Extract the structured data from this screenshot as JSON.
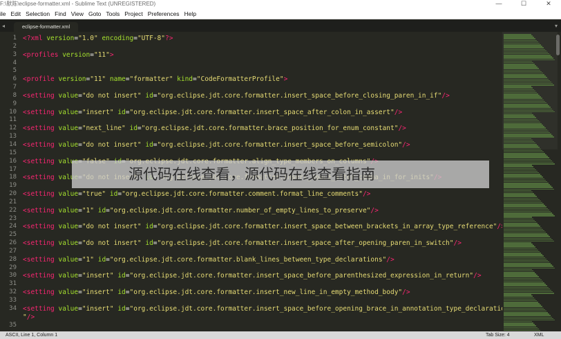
{
  "window": {
    "title": "F:\\默陈\\eclipse-formatter.xml - Sublime Text (UNREGISTERED)",
    "minimize": "—",
    "maximize": "☐",
    "close": "✕"
  },
  "menu": {
    "items": [
      "ile",
      "Edit",
      "Selection",
      "Find",
      "View",
      "Goto",
      "Tools",
      "Project",
      "Preferences",
      "Help"
    ]
  },
  "tabs": {
    "active": "eclipse-formatter.xml",
    "left_arrow": "◂",
    "right_arrow": "▾"
  },
  "editor": {
    "line_numbers": [
      "1",
      "2",
      "3",
      "4",
      "5",
      "6",
      "7",
      "8",
      "9",
      "10",
      "11",
      "12",
      "13",
      "14",
      "15",
      "16",
      "17",
      "18",
      "19",
      "20",
      "21",
      "22",
      "23",
      "24",
      "25",
      "26",
      "27",
      "28",
      "29",
      "30",
      "31",
      "32",
      "33",
      "34",
      "",
      "35"
    ],
    "lines": [
      [
        [
          "t",
          "<?xml"
        ],
        [
          "a",
          " version"
        ],
        [
          "p",
          "="
        ],
        [
          "s",
          "\"1.0\""
        ],
        [
          "a",
          " encoding"
        ],
        [
          "p",
          "="
        ],
        [
          "s",
          "\"UTF-8\""
        ],
        [
          "t",
          "?>"
        ]
      ],
      [],
      [
        [
          "t",
          "<profiles"
        ],
        [
          "a",
          " version"
        ],
        [
          "p",
          "="
        ],
        [
          "s",
          "\"11\""
        ],
        [
          "t",
          ">"
        ]
      ],
      [],
      [],
      [
        [
          "t",
          "<profile"
        ],
        [
          "a",
          " version"
        ],
        [
          "p",
          "="
        ],
        [
          "s",
          "\"11\""
        ],
        [
          "a",
          " name"
        ],
        [
          "p",
          "="
        ],
        [
          "s",
          "\"formatter\""
        ],
        [
          "a",
          " kind"
        ],
        [
          "p",
          "="
        ],
        [
          "s",
          "\"CodeFormatterProfile\""
        ],
        [
          "t",
          ">"
        ]
      ],
      [],
      [
        [
          "t",
          "<setting"
        ],
        [
          "a",
          " value"
        ],
        [
          "p",
          "="
        ],
        [
          "s",
          "\"do not insert\""
        ],
        [
          "a",
          " id"
        ],
        [
          "p",
          "="
        ],
        [
          "s",
          "\"org.eclipse.jdt.core.formatter.insert_space_before_closing_paren_in_if\""
        ],
        [
          "t",
          "/>"
        ]
      ],
      [],
      [
        [
          "t",
          "<setting"
        ],
        [
          "a",
          " value"
        ],
        [
          "p",
          "="
        ],
        [
          "s",
          "\"insert\""
        ],
        [
          "a",
          " id"
        ],
        [
          "p",
          "="
        ],
        [
          "s",
          "\"org.eclipse.jdt.core.formatter.insert_space_after_colon_in_assert\""
        ],
        [
          "t",
          "/>"
        ]
      ],
      [],
      [
        [
          "t",
          "<setting"
        ],
        [
          "a",
          " value"
        ],
        [
          "p",
          "="
        ],
        [
          "s",
          "\"next_line\""
        ],
        [
          "a",
          " id"
        ],
        [
          "p",
          "="
        ],
        [
          "s",
          "\"org.eclipse.jdt.core.formatter.brace_position_for_enum_constant\""
        ],
        [
          "t",
          "/>"
        ]
      ],
      [],
      [
        [
          "t",
          "<setting"
        ],
        [
          "a",
          " value"
        ],
        [
          "p",
          "="
        ],
        [
          "s",
          "\"do not insert\""
        ],
        [
          "a",
          " id"
        ],
        [
          "p",
          "="
        ],
        [
          "s",
          "\"org.eclipse.jdt.core.formatter.insert_space_before_semicolon\""
        ],
        [
          "t",
          "/>"
        ]
      ],
      [],
      [
        [
          "t",
          "<setting"
        ],
        [
          "a",
          " value"
        ],
        [
          "p",
          "="
        ],
        [
          "s",
          "\"false\""
        ],
        [
          "a",
          " id"
        ],
        [
          "p",
          "="
        ],
        [
          "s",
          "\"org.eclipse.jdt.core.formatter.align_type_members_on_columns\""
        ],
        [
          "t",
          "/>"
        ]
      ],
      [],
      [
        [
          "t",
          "<setting"
        ],
        [
          "a",
          " value"
        ],
        [
          "p",
          "="
        ],
        [
          "s",
          "\"do not insert\""
        ],
        [
          "a",
          " id"
        ],
        [
          "p",
          "="
        ],
        [
          "s",
          "\"org.eclipse.jdt.core.formatter.insert_space_after_comma_in_for_inits\""
        ],
        [
          "t",
          "/>"
        ]
      ],
      [],
      [
        [
          "t",
          "<setting"
        ],
        [
          "a",
          " value"
        ],
        [
          "p",
          "="
        ],
        [
          "s",
          "\"true\""
        ],
        [
          "a",
          " id"
        ],
        [
          "p",
          "="
        ],
        [
          "s",
          "\"org.eclipse.jdt.core.formatter.comment.format_line_comments\""
        ],
        [
          "t",
          "/>"
        ]
      ],
      [],
      [
        [
          "t",
          "<setting"
        ],
        [
          "a",
          " value"
        ],
        [
          "p",
          "="
        ],
        [
          "s",
          "\"1\""
        ],
        [
          "a",
          " id"
        ],
        [
          "p",
          "="
        ],
        [
          "s",
          "\"org.eclipse.jdt.core.formatter.number_of_empty_lines_to_preserve\""
        ],
        [
          "t",
          "/>"
        ]
      ],
      [],
      [
        [
          "t",
          "<setting"
        ],
        [
          "a",
          " value"
        ],
        [
          "p",
          "="
        ],
        [
          "s",
          "\"do not insert\""
        ],
        [
          "a",
          " id"
        ],
        [
          "p",
          "="
        ],
        [
          "s",
          "\"org.eclipse.jdt.core.formatter.insert_space_between_brackets_in_array_type_reference\""
        ],
        [
          "t",
          "/>"
        ]
      ],
      [],
      [
        [
          "t",
          "<setting"
        ],
        [
          "a",
          " value"
        ],
        [
          "p",
          "="
        ],
        [
          "s",
          "\"do not insert\""
        ],
        [
          "a",
          " id"
        ],
        [
          "p",
          "="
        ],
        [
          "s",
          "\"org.eclipse.jdt.core.formatter.insert_space_after_opening_paren_in_switch\""
        ],
        [
          "t",
          "/>"
        ]
      ],
      [],
      [
        [
          "t",
          "<setting"
        ],
        [
          "a",
          " value"
        ],
        [
          "p",
          "="
        ],
        [
          "s",
          "\"1\""
        ],
        [
          "a",
          " id"
        ],
        [
          "p",
          "="
        ],
        [
          "s",
          "\"org.eclipse.jdt.core.formatter.blank_lines_between_type_declarations\""
        ],
        [
          "t",
          "/>"
        ]
      ],
      [],
      [
        [
          "t",
          "<setting"
        ],
        [
          "a",
          " value"
        ],
        [
          "p",
          "="
        ],
        [
          "s",
          "\"insert\""
        ],
        [
          "a",
          " id"
        ],
        [
          "p",
          "="
        ],
        [
          "s",
          "\"org.eclipse.jdt.core.formatter.insert_space_before_parenthesized_expression_in_return\""
        ],
        [
          "t",
          "/>"
        ]
      ],
      [],
      [
        [
          "t",
          "<setting"
        ],
        [
          "a",
          " value"
        ],
        [
          "p",
          "="
        ],
        [
          "s",
          "\"insert\""
        ],
        [
          "a",
          " id"
        ],
        [
          "p",
          "="
        ],
        [
          "s",
          "\"org.eclipse.jdt.core.formatter.insert_new_line_in_empty_method_body\""
        ],
        [
          "t",
          "/>"
        ]
      ],
      [],
      [
        [
          "t",
          "<setting"
        ],
        [
          "a",
          " value"
        ],
        [
          "p",
          "="
        ],
        [
          "s",
          "\"insert\""
        ],
        [
          "a",
          " id"
        ],
        [
          "p",
          "="
        ],
        [
          "s",
          "\"org.eclipse.jdt.core.formatter.insert_space_before_opening_brace_in_annotation_type_declaration"
        ]
      ],
      [
        [
          "s",
          "\""
        ],
        [
          "t",
          "/>"
        ]
      ],
      []
    ]
  },
  "overlay": {
    "text": "源代码在线查看，源代码在线查看指南"
  },
  "status": {
    "left": "ASCII, Line 1, Column 1",
    "tab_size": "Tab Size: 4",
    "syntax": "XML"
  }
}
